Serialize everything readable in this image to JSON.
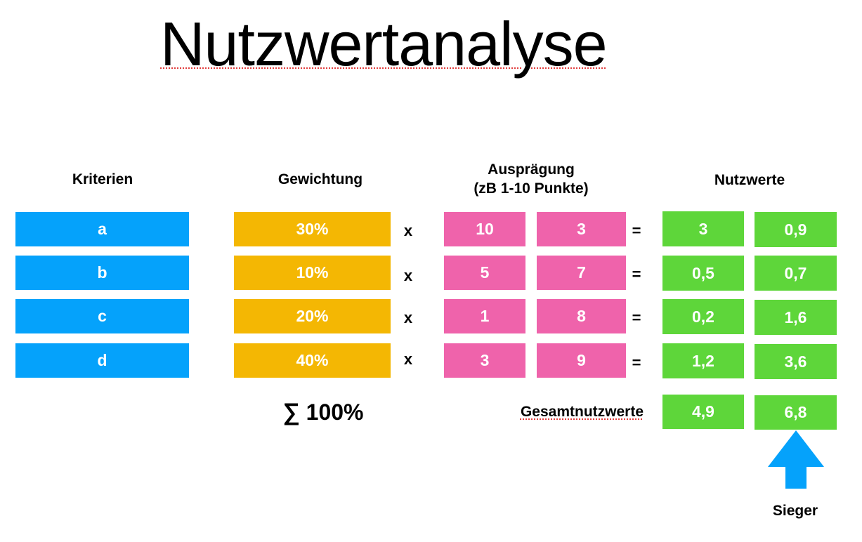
{
  "title": "Nutzwertanalyse",
  "headers": {
    "kriterien": "Kriterien",
    "gewichtung": "Gewichtung",
    "auspraegung_line1": "Ausprägung",
    "auspraegung_line2": "(zB 1-10 Punkte)",
    "nutzwerte": "Nutzwerte"
  },
  "operators": {
    "multiply": "x",
    "equals": "="
  },
  "rows": [
    {
      "kriterium": "a",
      "gewichtung": "30%",
      "auspraegung_1": "10",
      "auspraegung_2": "3",
      "nutzwert_1": "3",
      "nutzwert_2": "0,9"
    },
    {
      "kriterium": "b",
      "gewichtung": "10%",
      "auspraegung_1": "5",
      "auspraegung_2": "7",
      "nutzwert_1": "0,5",
      "nutzwert_2": "0,7"
    },
    {
      "kriterium": "c",
      "gewichtung": "20%",
      "auspraegung_1": "1",
      "auspraegung_2": "8",
      "nutzwert_1": "0,2",
      "nutzwert_2": "1,6"
    },
    {
      "kriterium": "d",
      "gewichtung": "40%",
      "auspraegung_1": "3",
      "auspraegung_2": "9",
      "nutzwert_1": "1,2",
      "nutzwert_2": "3,6"
    }
  ],
  "sum": {
    "symbol": "∑",
    "value": "100%"
  },
  "gesamt": {
    "label": "Gesamtnutzwerte",
    "value_1": "4,9",
    "value_2": "6,8"
  },
  "winner_label": "Sieger",
  "colors": {
    "kriterien": "#05a2fb",
    "gewichtung": "#f4b703",
    "auspraegung": "#ef63ab",
    "nutzwerte": "#5ed63a",
    "arrow": "#05a2fb"
  }
}
